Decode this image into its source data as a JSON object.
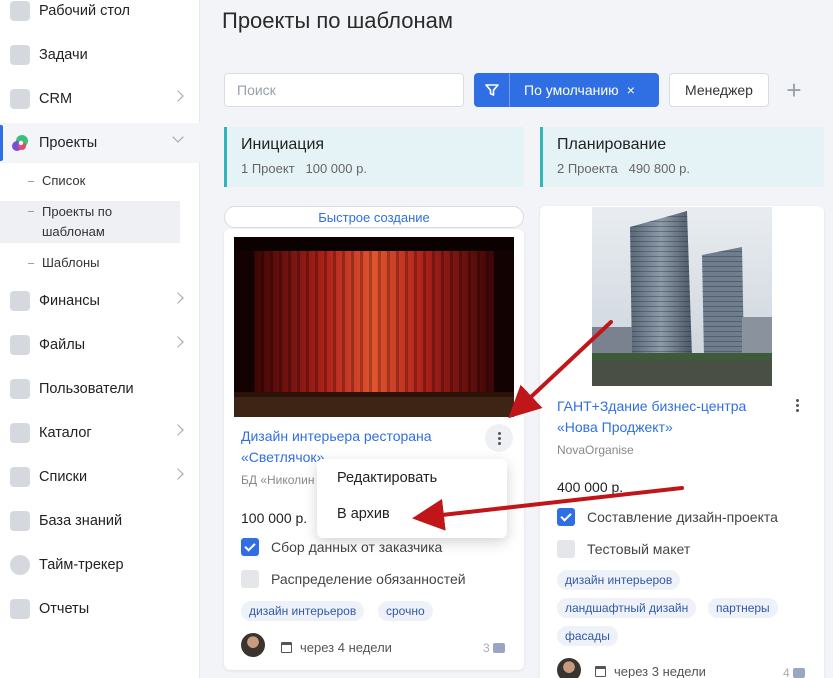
{
  "sidebar": {
    "items": [
      {
        "label": "Рабочий стол",
        "icon": "heart-icon",
        "chevron": false
      },
      {
        "label": "Задачи",
        "icon": "tasks-icon",
        "chevron": false
      },
      {
        "label": "CRM",
        "icon": "crm-icon",
        "chevron": true
      },
      {
        "label": "Проекты",
        "icon": "projects-icon",
        "chevron": true,
        "expanded": true,
        "active": true
      },
      {
        "label": "Финансы",
        "icon": "finance-icon",
        "chevron": true
      },
      {
        "label": "Файлы",
        "icon": "files-icon",
        "chevron": true
      },
      {
        "label": "Пользователи",
        "icon": "users-icon",
        "chevron": false
      },
      {
        "label": "Каталог",
        "icon": "catalog-icon",
        "chevron": true
      },
      {
        "label": "Списки",
        "icon": "lists-icon",
        "chevron": true
      },
      {
        "label": "База знаний",
        "icon": "knowledge-base-icon",
        "chevron": false
      },
      {
        "label": "Тайм-трекер",
        "icon": "time-tracker-icon",
        "chevron": false
      },
      {
        "label": "Отчеты",
        "icon": "reports-icon",
        "chevron": false
      }
    ],
    "subitems": [
      {
        "label": "Список"
      },
      {
        "label": "Проекты по шаблонам",
        "active": true
      },
      {
        "label": "Шаблоны"
      }
    ]
  },
  "page": {
    "title": "Проекты по шаблонам"
  },
  "toolbar": {
    "search_placeholder": "Поиск",
    "filter_label": "По умолчанию",
    "filter_close": "×",
    "manager_label": "Менеджер",
    "plus": "+"
  },
  "columns": [
    {
      "title": "Инициация",
      "summary": "1 Проект   100 000 р."
    },
    {
      "title": "Планирование",
      "summary": "2 Проекта   490 800 р."
    }
  ],
  "quick_create": "Быстрое создание",
  "cards": [
    {
      "title_line1": "Дизайн интерьера ресторана",
      "title_line2": "«Светлячок»",
      "subtitle": "БД «Николин",
      "price": "100 000 р.",
      "tasks": [
        {
          "label": "Сбор данных от заказчика",
          "done": true
        },
        {
          "label": "Распределение обязанностей",
          "done": false
        }
      ],
      "tags": [
        "дизайн интерьеров",
        "срочно"
      ],
      "due": "через 4 недели",
      "comments": "3"
    },
    {
      "title_line1": "ГАНТ+Здание бизнес-центра",
      "title_line2": "«Нова Проджект»",
      "subtitle": "NovaOrganise",
      "price": "400 000 р.",
      "tasks": [
        {
          "label": "Составление дизайн-проекта",
          "done": true
        },
        {
          "label": "Тестовый макет",
          "done": false
        }
      ],
      "tags": [
        "дизайн интерьеров",
        "ландшафтный дизайн",
        "партнеры",
        "фасады"
      ],
      "due": "через 3 недели",
      "comments": "4"
    }
  ],
  "context_menu": {
    "items": [
      "Редактировать",
      "В архив"
    ]
  },
  "colors": {
    "accent": "#2f6fe3",
    "column_border": "#33b4b9",
    "arrow": "#c0161a"
  }
}
